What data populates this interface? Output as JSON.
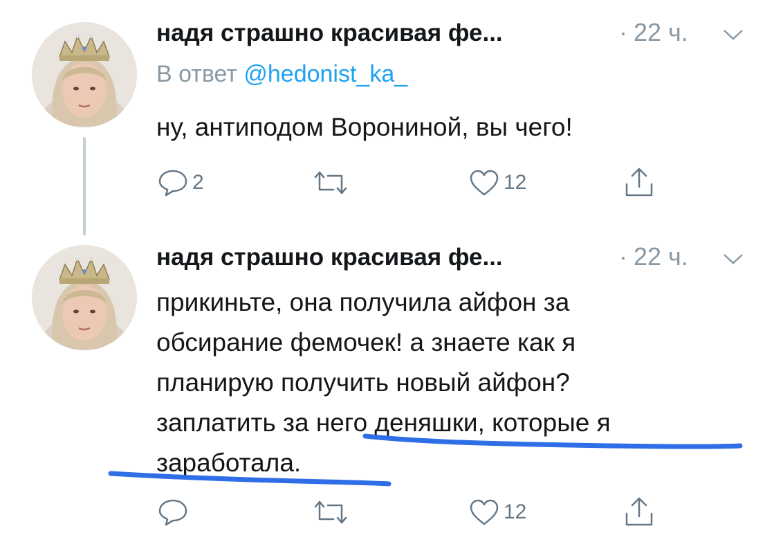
{
  "tweets": [
    {
      "author": "надя страшно красивая фе...",
      "sep": "·",
      "time": "22 ч.",
      "reply_prefix": "В ответ",
      "reply_handle": "@hedonist_ka_",
      "lines": [
        "ну, антиподом Ворониной, вы чего!"
      ],
      "actions": {
        "reply_count": "2",
        "retweet_count": "",
        "like_count": "12"
      }
    },
    {
      "author": "надя страшно красивая фе...",
      "sep": "·",
      "time": "22 ч.",
      "lines": [
        "прикиньте, она получила айфон за",
        "обсирание фемочек! а знаете как я",
        "планирую получить новый айфон?",
        "заплатить за него деняшки, которые я",
        "заработала."
      ],
      "actions": {
        "reply_count": "",
        "retweet_count": "",
        "like_count": "12"
      }
    }
  ],
  "colors": {
    "text": "#14171a",
    "muted": "#8899a6",
    "icon": "#657786",
    "link": "#1da1f2",
    "thread_line": "#c4cfd6",
    "marker": "#2f6ee6"
  },
  "icons": [
    "reply-icon",
    "retweet-icon",
    "like-icon",
    "share-icon",
    "chevron-down-icon"
  ]
}
